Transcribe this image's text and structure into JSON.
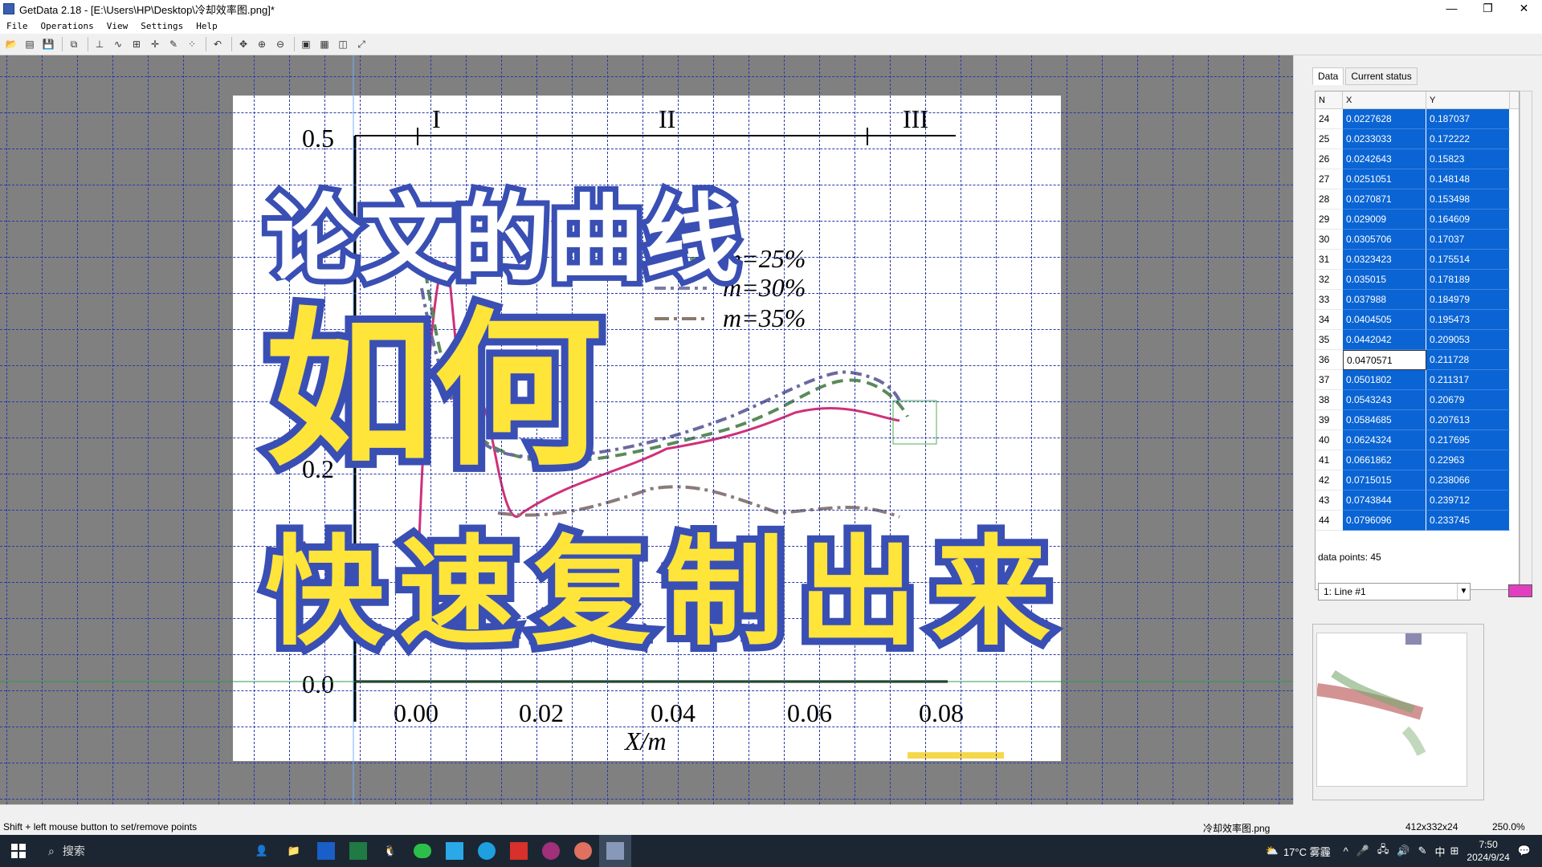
{
  "window": {
    "title": "GetData 2.18 - [E:\\Users\\HP\\Desktop\\冷却效率图.png]*",
    "minimize": "—",
    "maximize": "❐",
    "close": "✕"
  },
  "menu": [
    "File",
    "Operations",
    "View",
    "Settings",
    "Help"
  ],
  "plot": {
    "roman": [
      "I",
      "II",
      "III"
    ],
    "yticks": [
      "0.5",
      "0.2",
      "0.0"
    ],
    "xticks": [
      "0.00",
      "0.02",
      "0.04",
      "0.06",
      "0.08"
    ],
    "xlabel": "X/m",
    "legend": [
      "m=25%",
      "m=30%",
      "m=35%"
    ]
  },
  "overlay": {
    "line1": "论文的曲线",
    "line2": "如何",
    "line3": "快速复制出来"
  },
  "panel": {
    "tabs": [
      "Data",
      "Current status"
    ],
    "columns": [
      "N",
      "X",
      "Y"
    ],
    "rows": [
      {
        "n": "24",
        "x": "0.0227628",
        "y": "0.187037"
      },
      {
        "n": "25",
        "x": "0.0233033",
        "y": "0.172222"
      },
      {
        "n": "26",
        "x": "0.0242643",
        "y": "0.15823"
      },
      {
        "n": "27",
        "x": "0.0251051",
        "y": "0.148148"
      },
      {
        "n": "28",
        "x": "0.0270871",
        "y": "0.153498"
      },
      {
        "n": "29",
        "x": "0.029009",
        "y": "0.164609"
      },
      {
        "n": "30",
        "x": "0.0305706",
        "y": "0.17037"
      },
      {
        "n": "31",
        "x": "0.0323423",
        "y": "0.175514"
      },
      {
        "n": "32",
        "x": "0.035015",
        "y": "0.178189"
      },
      {
        "n": "33",
        "x": "0.037988",
        "y": "0.184979"
      },
      {
        "n": "34",
        "x": "0.0404505",
        "y": "0.195473"
      },
      {
        "n": "35",
        "x": "0.0442042",
        "y": "0.209053"
      },
      {
        "n": "36",
        "x": "0.0470571",
        "y": "0.211728"
      },
      {
        "n": "37",
        "x": "0.0501802",
        "y": "0.211317"
      },
      {
        "n": "38",
        "x": "0.0543243",
        "y": "0.20679"
      },
      {
        "n": "39",
        "x": "0.0584685",
        "y": "0.207613"
      },
      {
        "n": "40",
        "x": "0.0624324",
        "y": "0.217695"
      },
      {
        "n": "41",
        "x": "0.0661862",
        "y": "0.22963"
      },
      {
        "n": "42",
        "x": "0.0715015",
        "y": "0.238066"
      },
      {
        "n": "43",
        "x": "0.0743844",
        "y": "0.239712"
      },
      {
        "n": "44",
        "x": "0.0796096",
        "y": "0.233745"
      }
    ],
    "data_points": "data points: 45",
    "line_select": "1: Line #1",
    "line_color": "#e040c0"
  },
  "status": {
    "hint": "Shift + left mouse button to set/remove points",
    "file": "冷却效率图.png",
    "size": "412x332x24",
    "zoom": "250.0%"
  },
  "taskbar": {
    "search": "搜索",
    "weather": "17°C 雾霾",
    "ime": "中",
    "time": "7:50",
    "date": "2024/9/24"
  }
}
